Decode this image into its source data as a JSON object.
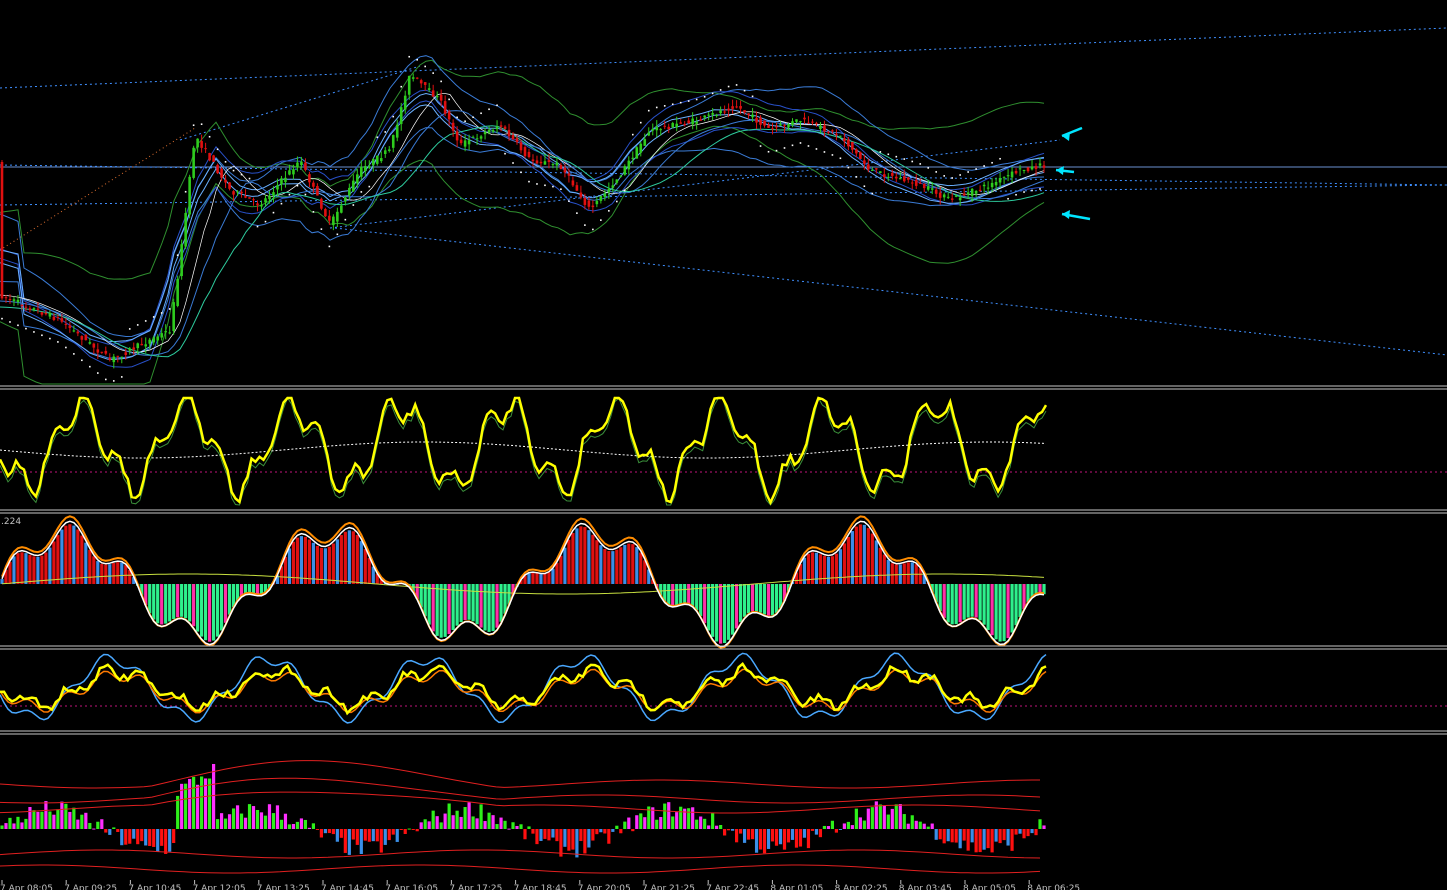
{
  "chart_data": {
    "type": "line",
    "background": "#000000",
    "panes": [
      {
        "id": "price",
        "kind": "candlestick",
        "colors": {
          "bull": "#2ecc1e",
          "bear": "#e01010",
          "bands": [
            "#3a7bd5",
            "#2850c8",
            "#2f8f2f",
            "#6ab0ff"
          ],
          "sar": "#ffffff",
          "trend_lines": "#3f8fff"
        },
        "markers": [
          "arrow-upper",
          "arrow-middle",
          "arrow-lower"
        ],
        "marker_color": "#00e5ff"
      },
      {
        "id": "oscillator-1",
        "kind": "line",
        "colors": {
          "main": "#ffff00",
          "signal": "#ffffff",
          "level": "#c0147a"
        }
      },
      {
        "id": "macd-histogram",
        "kind": "histogram",
        "label": ".224",
        "colors": {
          "pos_fill": "#e01010",
          "pos_hist": "#3a8fe8",
          "neg_hist": "#2ef08c",
          "neg_hist_alt": "#ff2fa8",
          "line": "#ffffff",
          "line2": "#ff8c00",
          "slow": "#c8e040"
        }
      },
      {
        "id": "oscillator-2",
        "kind": "line",
        "colors": {
          "main": "#ffff00",
          "fast": "#ff7a00",
          "slow": "#4aa8ff",
          "level": "#c0147a"
        }
      },
      {
        "id": "volume-histogram",
        "kind": "histogram",
        "colors": {
          "pos_a": "#2ef01a",
          "pos_b": "#ff2fff",
          "neg_a": "#ff1010",
          "neg_b": "#3a8fe8",
          "envelope": "#e02020"
        }
      }
    ],
    "x_tick_labels": [
      "7 Apr 08:05",
      "7 Apr 09:25",
      "7 Apr 10:45",
      "7 Apr 12:05",
      "7 Apr 13:25",
      "7 Apr 14:45",
      "7 Apr 16:05",
      "7 Apr 17:25",
      "7 Apr 18:45",
      "7 Apr 20:05",
      "7 Apr 21:25",
      "7 Apr 22:45",
      "8 Apr 01:05",
      "8 Apr 02:25",
      "8 Apr 03:45",
      "8 Apr 05:05",
      "8 Apr 06:25"
    ]
  }
}
